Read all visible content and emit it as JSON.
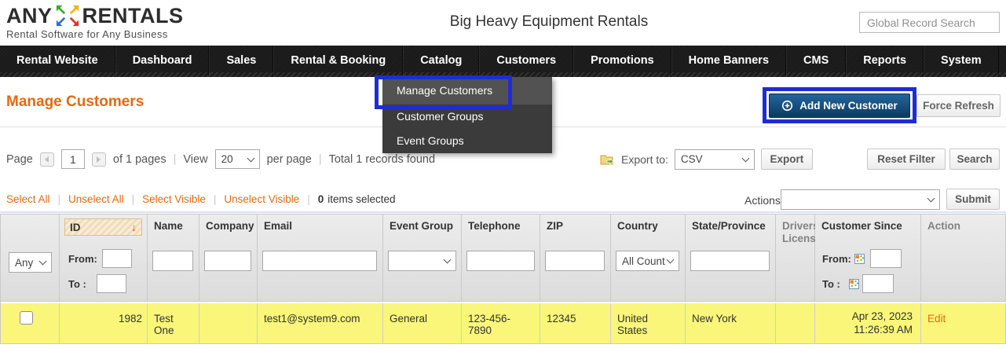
{
  "brand": {
    "name_left": "ANY",
    "name_right": "RENTALS",
    "tagline": "Rental Software for Any Business"
  },
  "header": {
    "site_title": "Big Heavy Equipment Rentals",
    "global_search_placeholder": "Global Record Search"
  },
  "nav": {
    "items": [
      "Rental Website",
      "Dashboard",
      "Sales",
      "Rental & Booking",
      "Catalog",
      "Customers",
      "Promotions",
      "Home Banners",
      "CMS",
      "Reports",
      "System"
    ]
  },
  "customers_menu": {
    "items": [
      "Manage Customers",
      "Customer Groups",
      "Event Groups"
    ],
    "highlighted": "Manage Customers"
  },
  "page": {
    "title": "Manage Customers",
    "add_new_customer": "Add New Customer",
    "force_refresh": "Force Refresh"
  },
  "pagination": {
    "page_label": "Page",
    "page_value": "1",
    "of_pages": "of 1 pages",
    "view_label": "View",
    "per_page_value": "20",
    "per_page_label": "per page",
    "total_records": "Total 1 records found"
  },
  "export": {
    "label": "Export to:",
    "format": "CSV",
    "button": "Export"
  },
  "filter_actions": {
    "reset": "Reset Filter",
    "search": "Search"
  },
  "selection": {
    "select_all": "Select All",
    "unselect_all": "Unselect All",
    "select_visible": "Select Visible",
    "unselect_visible": "Unselect Visible",
    "count": "0",
    "count_suffix": "items selected"
  },
  "actions_bar": {
    "label": "Actions",
    "submit": "Submit"
  },
  "table": {
    "columns": [
      "",
      "ID",
      "Name",
      "Company",
      "Email",
      "Event Group",
      "Telephone",
      "ZIP",
      "Country",
      "State/Province",
      "Drivers License",
      "Customer Since",
      "Action"
    ],
    "sort": {
      "column": "ID",
      "direction": "desc"
    },
    "filters": {
      "any": "Any",
      "from": "From:",
      "to": "To :",
      "country_value": "All Count"
    },
    "row": {
      "id": "1982",
      "name": "Test One",
      "company": "",
      "email": "test1@system9.com",
      "event_group": "General",
      "telephone": "123-456-7890",
      "zip": "12345",
      "country": "United States",
      "state_province": "New York",
      "drivers_license": "",
      "customer_since_date": "Apr 23, 2023",
      "customer_since_time": "11:26:39 AM",
      "action": "Edit"
    }
  },
  "colors": {
    "accent_orange": "#E4690F",
    "annotation_blue": "#1E2CD5",
    "add_button_blue": "#14507F",
    "row_highlight_yellow": "#FAF679",
    "nav_background": "#191919"
  }
}
